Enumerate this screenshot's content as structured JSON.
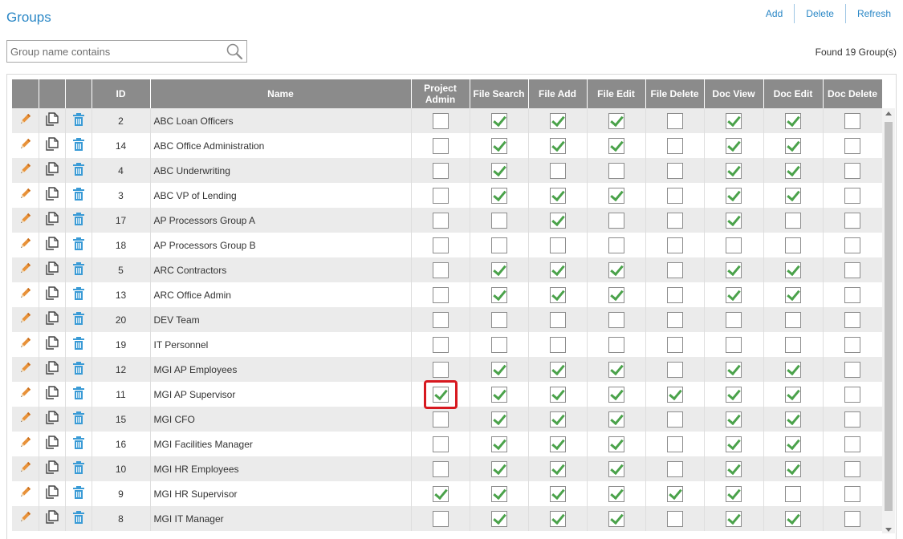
{
  "page": {
    "title": "Groups"
  },
  "actions": {
    "add": "Add",
    "delete": "Delete",
    "refresh": "Refresh"
  },
  "search": {
    "placeholder": "Group name contains",
    "value": ""
  },
  "found": "Found 19 Group(s)",
  "columns": [
    "ID",
    "Name",
    "Project Admin",
    "File Search",
    "File Add",
    "File Edit",
    "File Delete",
    "Doc View",
    "Doc Edit",
    "Doc Delete"
  ],
  "colors": {
    "accent": "#2a87c6",
    "header": "#8b8b8b",
    "check": "#4aa24a",
    "highlight": "#d71920",
    "pencil": "#e8923a",
    "trash": "#3a9bd6"
  },
  "row_icons": [
    "pencil-icon",
    "copy-icon",
    "trash-icon"
  ],
  "rows": [
    {
      "id": "2",
      "name": "ABC Loan Officers",
      "perms": [
        false,
        true,
        true,
        true,
        false,
        true,
        true,
        false
      ]
    },
    {
      "id": "14",
      "name": "ABC Office Administration",
      "perms": [
        false,
        true,
        true,
        true,
        false,
        true,
        true,
        false
      ]
    },
    {
      "id": "4",
      "name": "ABC Underwriting",
      "perms": [
        false,
        true,
        false,
        false,
        false,
        true,
        true,
        false
      ]
    },
    {
      "id": "3",
      "name": "ABC VP of Lending",
      "perms": [
        false,
        true,
        true,
        true,
        false,
        true,
        true,
        false
      ]
    },
    {
      "id": "17",
      "name": "AP Processors Group A",
      "perms": [
        false,
        false,
        true,
        false,
        false,
        true,
        false,
        false
      ]
    },
    {
      "id": "18",
      "name": "AP Processors Group B",
      "perms": [
        false,
        false,
        false,
        false,
        false,
        false,
        false,
        false
      ]
    },
    {
      "id": "5",
      "name": "ARC Contractors",
      "perms": [
        false,
        true,
        true,
        true,
        false,
        true,
        true,
        false
      ]
    },
    {
      "id": "13",
      "name": "ARC Office Admin",
      "perms": [
        false,
        true,
        true,
        true,
        false,
        true,
        true,
        false
      ]
    },
    {
      "id": "20",
      "name": "DEV Team",
      "perms": [
        false,
        false,
        false,
        false,
        false,
        false,
        false,
        false
      ]
    },
    {
      "id": "19",
      "name": "IT Personnel",
      "perms": [
        false,
        false,
        false,
        false,
        false,
        false,
        false,
        false
      ]
    },
    {
      "id": "12",
      "name": "MGI AP Employees",
      "perms": [
        false,
        true,
        true,
        true,
        false,
        true,
        true,
        false
      ]
    },
    {
      "id": "11",
      "name": "MGI AP Supervisor",
      "perms": [
        true,
        true,
        true,
        true,
        true,
        true,
        true,
        false
      ]
    },
    {
      "id": "15",
      "name": "MGI CFO",
      "perms": [
        false,
        true,
        true,
        true,
        false,
        true,
        true,
        false
      ]
    },
    {
      "id": "16",
      "name": "MGI Facilities Manager",
      "perms": [
        false,
        true,
        true,
        true,
        false,
        true,
        true,
        false
      ]
    },
    {
      "id": "10",
      "name": "MGI HR Employees",
      "perms": [
        false,
        true,
        true,
        true,
        false,
        true,
        true,
        false
      ]
    },
    {
      "id": "9",
      "name": "MGI HR Supervisor",
      "perms": [
        true,
        true,
        true,
        true,
        true,
        true,
        false,
        false
      ]
    },
    {
      "id": "8",
      "name": "MGI IT Manager",
      "perms": [
        false,
        true,
        true,
        true,
        false,
        true,
        true,
        false
      ]
    }
  ]
}
